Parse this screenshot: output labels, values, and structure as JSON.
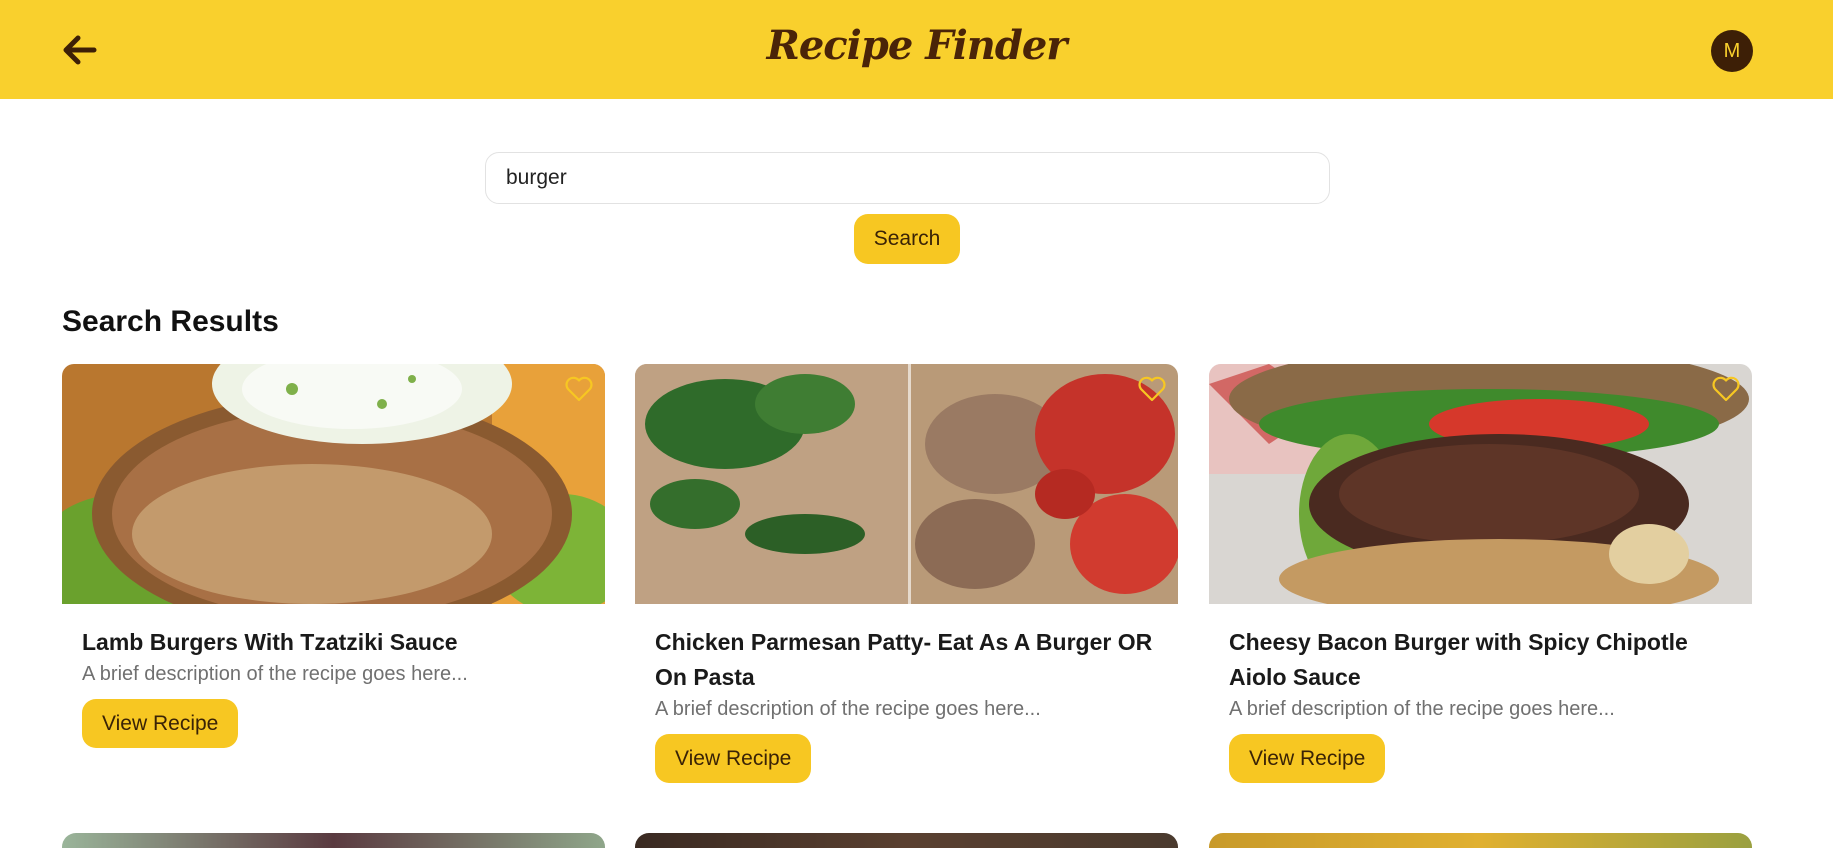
{
  "header": {
    "title": "Recipe Finder",
    "avatar_initial": "M",
    "back_icon": "arrow-left-icon",
    "background": "#f9d02d"
  },
  "search": {
    "value": "burger",
    "button_label": "Search"
  },
  "results": {
    "heading": "Search Results",
    "cards": [
      {
        "title": "Lamb Burgers With Tzatziki Sauce",
        "description": "A brief description of the recipe goes here...",
        "button_label": "View Recipe",
        "favorite_icon": "heart-outline-icon"
      },
      {
        "title": "Chicken Parmesan Patty- Eat As A Burger OR On Pasta",
        "description": "A brief description of the recipe goes here...",
        "button_label": "View Recipe",
        "favorite_icon": "heart-outline-icon"
      },
      {
        "title": "Cheesy Bacon Burger with Spicy Chipotle Aiolo Sauce",
        "description": "A brief description of the recipe goes here...",
        "button_label": "View Recipe",
        "favorite_icon": "heart-outline-icon"
      }
    ]
  },
  "colors": {
    "accent": "#f7c722",
    "brand_dark": "#4a2408",
    "muted_text": "#707070"
  }
}
